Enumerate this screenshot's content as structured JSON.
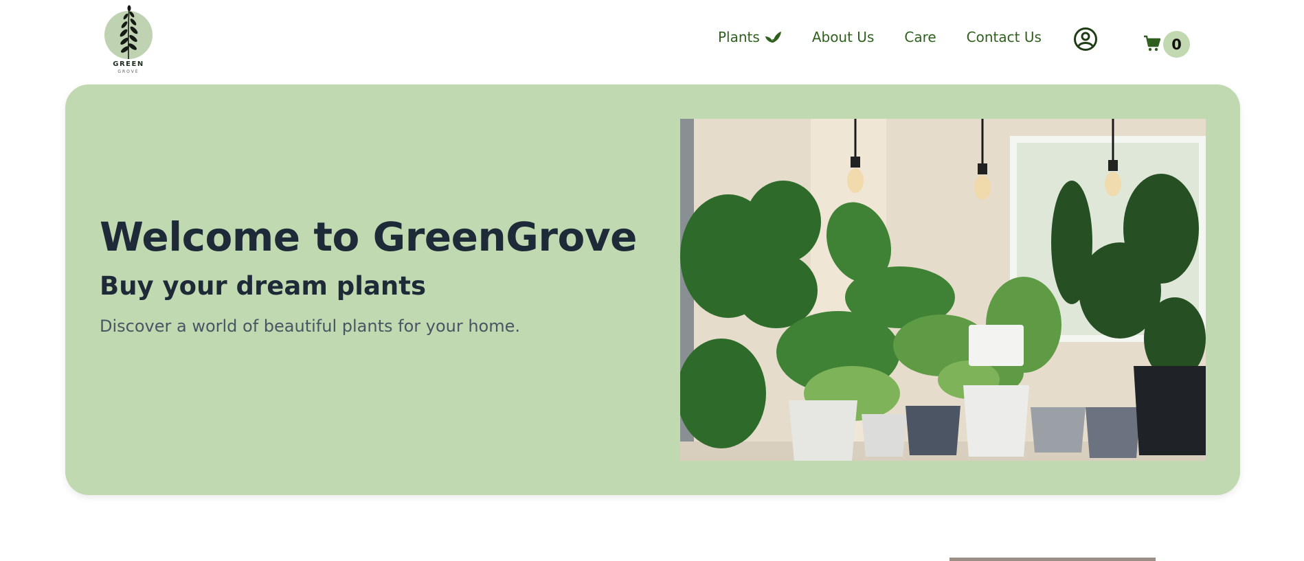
{
  "logo": {
    "word": "GREEN",
    "sub": "GROVE"
  },
  "nav": {
    "plants_label": "Plants",
    "about_label": "About Us",
    "care_label": "Care",
    "contact_label": "Contact Us"
  },
  "cart": {
    "count": "0"
  },
  "hero": {
    "title": "Welcome to GreenGrove",
    "subtitle": "Buy your dream plants",
    "description": "Discover a world of beautiful plants for your home."
  },
  "icons": {
    "leaf": "leaf-icon",
    "account": "user-circle-icon",
    "cart": "shopping-cart-icon"
  },
  "colors": {
    "accent": "#2f5f1d",
    "hero_bg": "#c1d9b0",
    "badge_bg": "#c2d8b0",
    "heading": "#1e2a38",
    "body_text": "#4a5563"
  }
}
